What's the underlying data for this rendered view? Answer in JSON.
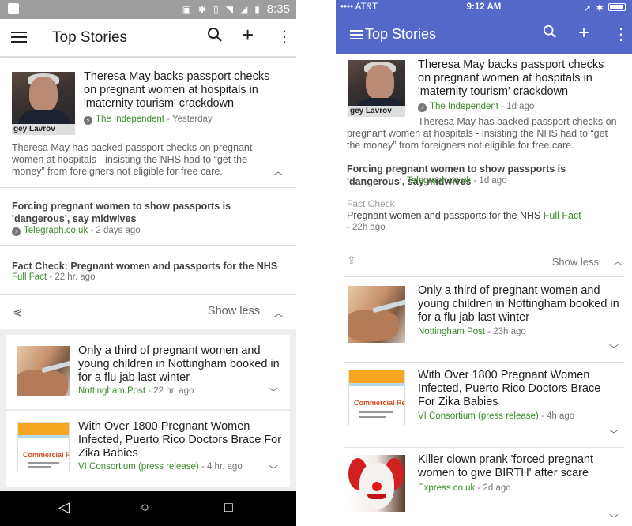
{
  "android": {
    "status_bar": {
      "time": "8:35"
    },
    "toolbar": {
      "title": "Top Stories"
    },
    "main_story": {
      "thumb_caption": "gey Lavrov",
      "headline": "Theresa May backs passport checks on pregnant women at hospitals in 'maternity tourism' crackdown",
      "source": "The Independent",
      "time": " - Yesterday",
      "snippet": "Theresa May has backed passport checks on pregnant women at hospitals - insisting the NHS had to “get the money” from foreigners not eligible for free care."
    },
    "related_1": {
      "headline": "Forcing pregnant women to show passports is 'dangerous', say midwives",
      "source": "Telegraph.co.uk",
      "time": " - 2 days ago"
    },
    "related_2": {
      "headline": "Fact Check: Pregnant women and passports for the NHS",
      "source": "Full Fact",
      "time": " - 22 hr. ago"
    },
    "show_less": "Show less",
    "story_2": {
      "headline": "Only a third of pregnant women and young children in Nottingham booked in for a flu jab last winter",
      "source": "Nottingham Post",
      "time": " - 22 hr. ago"
    },
    "story_3": {
      "headline": "With Over 1800 Pregnant Women Infected, Puerto Rico Doctors Brace For Zika Babies",
      "source": "VI Consortium (press release)",
      "time": " - 4 hr. ago",
      "thumb_text": "Commercial Real Estate"
    }
  },
  "ios": {
    "status_bar": {
      "carrier": "•••• AT&T",
      "time": "9:12 AM"
    },
    "toolbar": {
      "title": "Top Stories"
    },
    "main_story": {
      "headline": "Theresa May backs passport checks on pregnant women at hospitals in 'maternity tourism' crackdown",
      "source": "The Independent",
      "time": " - 1d ago",
      "snippet": "Theresa May has backed passport checks on pregnant women at hospitals - insisting the NHS had to “get the money” from foreigners not eligible for free care."
    },
    "related_1": {
      "headline": "Forcing pregnant women to show passports is 'dangerous', say midwives",
      "source": "Telegraph.co.uk",
      "time": " - 1d ago"
    },
    "related_2": {
      "label": "Fact Check",
      "headline": "Pregnant women and passports for the NHS",
      "source": "Full Fact",
      "time": " - 22h ago"
    },
    "show_less": "Show less",
    "story_2": {
      "headline": "Only a third of pregnant women and young children in Nottingham booked in for a flu jab last winter",
      "source": "Nottingham Post",
      "time": " - 23h ago"
    },
    "story_3": {
      "headline": "With Over 1800 Pregnant Women Infected, Puerto Rico Doctors Brace For Zika Babies",
      "source": "VI Consortium (press release)",
      "time": " - 4h ago",
      "thumb_text": "Commercial Real Estate"
    },
    "story_4": {
      "headline": "Killer clown prank 'forced pregnant women to give BIRTH' after scare",
      "source": "Express.co.uk",
      "time": " - 2d ago"
    }
  },
  "colors": {
    "android_status": "#9e9e9e",
    "ios_header": "#5468c9",
    "source_green": "#3b8b2c"
  }
}
